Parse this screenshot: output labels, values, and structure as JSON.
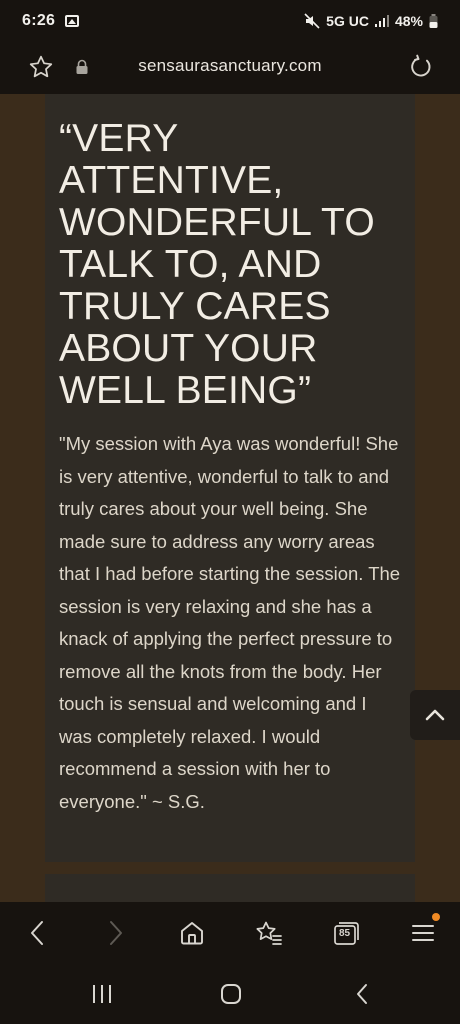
{
  "status_bar": {
    "time": "6:26",
    "network": "5G UC",
    "battery": "48%"
  },
  "browser": {
    "url": "sensaurasanctuary.com",
    "tab_count": "85"
  },
  "testimonial": {
    "heading": "“VERY ATTENTIVE, WONDERFUL TO TALK TO, AND TRULY CARES ABOUT YOUR WELL BEING”",
    "body": "\"My session with Aya was wonderful! She is very attentive, wonderful to talk to and truly cares about your well being. She made sure to address any worry areas that I had before starting the session. The session is very relaxing and she has a knack of applying the perfect pressure to remove all the knots from the body. Her touch is sensual and welcoming and I was completely relaxed. I would recommend a session with her to everyone.\" ~ S.G."
  },
  "colors": {
    "page_background": "#3b2c1b",
    "card_background": "#2f2b25",
    "chrome_background": "#17130f",
    "notification_dot": "#f08a24"
  },
  "icons": {
    "bookmark": "star-outline-icon",
    "secure": "lock-icon",
    "reload": "reload-icon",
    "scroll_top": "chevron-up-icon",
    "back": "chevron-left-icon",
    "forward": "chevron-right-icon",
    "home": "home-icon",
    "bookmarks": "star-list-icon",
    "tabs": "tabs-icon",
    "menu": "hamburger-menu-icon",
    "recents": "recents-icon",
    "system_home": "system-home-icon",
    "system_back": "system-back-icon"
  }
}
